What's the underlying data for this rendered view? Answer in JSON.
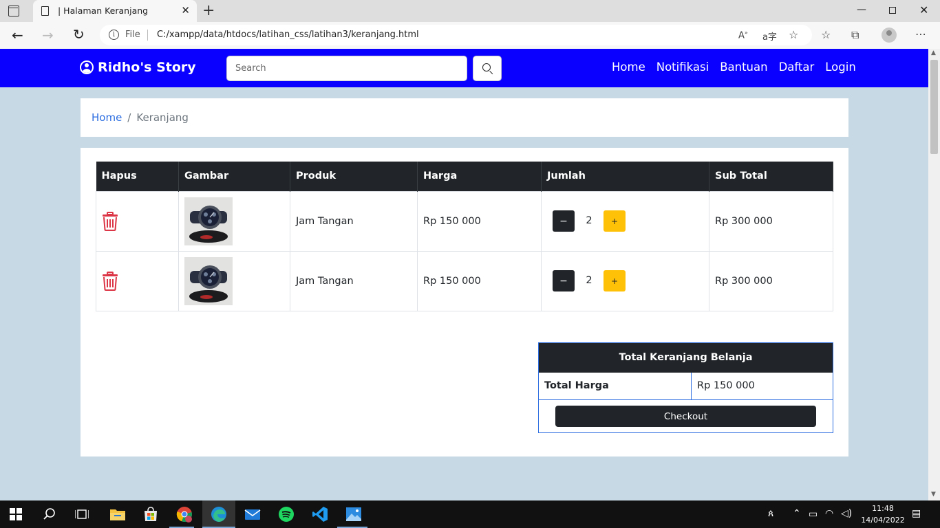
{
  "browser": {
    "tab_title": "| Halaman Keranjang",
    "url_scheme_label": "File",
    "url": "C:/xampp/data/htdocs/latihan_css/latihan3/keranjang.html"
  },
  "navbar": {
    "brand": "Ridho's Story",
    "search_placeholder": "Search",
    "links": [
      "Home",
      "Notifikasi",
      "Bantuan",
      "Daftar",
      "Login"
    ]
  },
  "breadcrumb": {
    "home": "Home",
    "separator": "/",
    "current": "Keranjang"
  },
  "cart": {
    "headers": [
      "Hapus",
      "Gambar",
      "Produk",
      "Harga",
      "Jumlah",
      "Sub Total"
    ],
    "rows": [
      {
        "product": "Jam Tangan",
        "price": "Rp 150 000",
        "qty": "2",
        "subtotal": "Rp 300 000"
      },
      {
        "product": "Jam Tangan",
        "price": "Rp 150 000",
        "qty": "2",
        "subtotal": "Rp 300 000"
      }
    ],
    "minus_label": "−",
    "plus_label": "+"
  },
  "summary": {
    "title": "Total Keranjang Belanja",
    "total_label": "Total Harga",
    "total_value": "Rp 150 000",
    "checkout_label": "Checkout"
  },
  "taskbar": {
    "time": "11:48",
    "date": "14/04/2022"
  },
  "colors": {
    "navbar": "#0a00ff",
    "page_bg": "#c6d9e4",
    "dark": "#212529",
    "warning": "#ffc107",
    "danger": "#dc3545",
    "link": "#2b6de0"
  }
}
